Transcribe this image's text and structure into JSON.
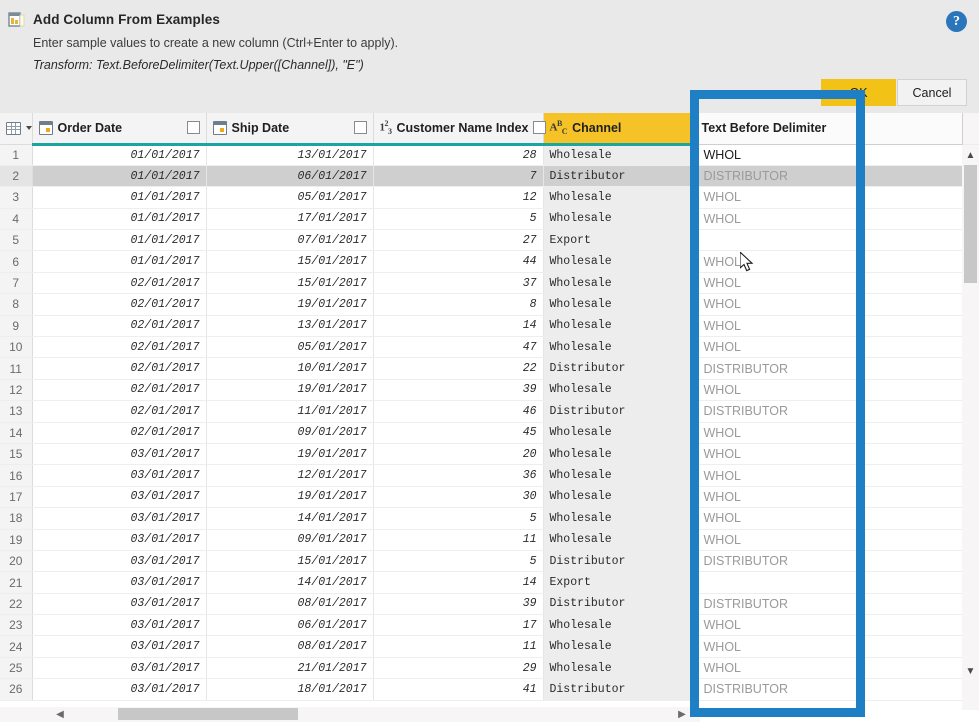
{
  "dialog": {
    "icon": "add-column-icon",
    "title": "Add Column From Examples",
    "subtitle": "Enter sample values to create a new column (Ctrl+Enter to apply).",
    "transform": "Transform: Text.BeforeDelimiter(Text.Upper([Channel]), \"E\")",
    "help_icon": "help-icon",
    "ok_label": "OK",
    "cancel_label": "Cancel"
  },
  "colors": {
    "accent_yellow": "#f2c316",
    "header_highlight": "#f5c327",
    "header_underline_teal": "#1aa5a0",
    "annotation_blue": "#1f7fc4",
    "help_blue": "#2b76bb",
    "selected_row": "#cfcfcf"
  },
  "grid": {
    "index_header_icon": "table-grid-icon",
    "index_header_caret": "chevron-down-icon",
    "columns": [
      {
        "key": "order_date",
        "label": "Order Date",
        "type_icon": "date-type-icon",
        "checkbox": true,
        "highlight": false
      },
      {
        "key": "ship_date",
        "label": "Ship Date",
        "type_icon": "date-type-icon",
        "checkbox": true,
        "highlight": false
      },
      {
        "key": "customer_name_index",
        "label": "Customer Name Index",
        "type_icon": "number-type-icon",
        "checkbox": true,
        "highlight": false
      },
      {
        "key": "channel",
        "label": "Channel",
        "type_icon": "text-type-icon",
        "checkbox": false,
        "highlight": true
      }
    ],
    "new_column": {
      "label": "Text Before Delimiter",
      "is_preview": true
    },
    "rows": [
      {
        "n": "1",
        "order_date": "01/01/2017",
        "ship_date": "13/01/2017",
        "customer_name_index": "28",
        "channel": "Wholesale",
        "preview": "WHOL",
        "entered": true,
        "selected": false
      },
      {
        "n": "2",
        "order_date": "01/01/2017",
        "ship_date": "06/01/2017",
        "customer_name_index": "7",
        "channel": "Distributor",
        "preview": "DISTRIBUTOR",
        "entered": false,
        "selected": true
      },
      {
        "n": "3",
        "order_date": "01/01/2017",
        "ship_date": "05/01/2017",
        "customer_name_index": "12",
        "channel": "Wholesale",
        "preview": "WHOL",
        "entered": false,
        "selected": false
      },
      {
        "n": "4",
        "order_date": "01/01/2017",
        "ship_date": "17/01/2017",
        "customer_name_index": "5",
        "channel": "Wholesale",
        "preview": "WHOL",
        "entered": false,
        "selected": false
      },
      {
        "n": "5",
        "order_date": "01/01/2017",
        "ship_date": "07/01/2017",
        "customer_name_index": "27",
        "channel": "Export",
        "preview": "",
        "entered": false,
        "selected": false
      },
      {
        "n": "6",
        "order_date": "01/01/2017",
        "ship_date": "15/01/2017",
        "customer_name_index": "44",
        "channel": "Wholesale",
        "preview": "WHOL",
        "entered": false,
        "selected": false
      },
      {
        "n": "7",
        "order_date": "02/01/2017",
        "ship_date": "15/01/2017",
        "customer_name_index": "37",
        "channel": "Wholesale",
        "preview": "WHOL",
        "entered": false,
        "selected": false
      },
      {
        "n": "8",
        "order_date": "02/01/2017",
        "ship_date": "19/01/2017",
        "customer_name_index": "8",
        "channel": "Wholesale",
        "preview": "WHOL",
        "entered": false,
        "selected": false
      },
      {
        "n": "9",
        "order_date": "02/01/2017",
        "ship_date": "13/01/2017",
        "customer_name_index": "14",
        "channel": "Wholesale",
        "preview": "WHOL",
        "entered": false,
        "selected": false
      },
      {
        "n": "10",
        "order_date": "02/01/2017",
        "ship_date": "05/01/2017",
        "customer_name_index": "47",
        "channel": "Wholesale",
        "preview": "WHOL",
        "entered": false,
        "selected": false
      },
      {
        "n": "11",
        "order_date": "02/01/2017",
        "ship_date": "10/01/2017",
        "customer_name_index": "22",
        "channel": "Distributor",
        "preview": "DISTRIBUTOR",
        "entered": false,
        "selected": false
      },
      {
        "n": "12",
        "order_date": "02/01/2017",
        "ship_date": "19/01/2017",
        "customer_name_index": "39",
        "channel": "Wholesale",
        "preview": "WHOL",
        "entered": false,
        "selected": false
      },
      {
        "n": "13",
        "order_date": "02/01/2017",
        "ship_date": "11/01/2017",
        "customer_name_index": "46",
        "channel": "Distributor",
        "preview": "DISTRIBUTOR",
        "entered": false,
        "selected": false
      },
      {
        "n": "14",
        "order_date": "02/01/2017",
        "ship_date": "09/01/2017",
        "customer_name_index": "45",
        "channel": "Wholesale",
        "preview": "WHOL",
        "entered": false,
        "selected": false
      },
      {
        "n": "15",
        "order_date": "03/01/2017",
        "ship_date": "19/01/2017",
        "customer_name_index": "20",
        "channel": "Wholesale",
        "preview": "WHOL",
        "entered": false,
        "selected": false
      },
      {
        "n": "16",
        "order_date": "03/01/2017",
        "ship_date": "12/01/2017",
        "customer_name_index": "36",
        "channel": "Wholesale",
        "preview": "WHOL",
        "entered": false,
        "selected": false
      },
      {
        "n": "17",
        "order_date": "03/01/2017",
        "ship_date": "19/01/2017",
        "customer_name_index": "30",
        "channel": "Wholesale",
        "preview": "WHOL",
        "entered": false,
        "selected": false
      },
      {
        "n": "18",
        "order_date": "03/01/2017",
        "ship_date": "14/01/2017",
        "customer_name_index": "5",
        "channel": "Wholesale",
        "preview": "WHOL",
        "entered": false,
        "selected": false
      },
      {
        "n": "19",
        "order_date": "03/01/2017",
        "ship_date": "09/01/2017",
        "customer_name_index": "11",
        "channel": "Wholesale",
        "preview": "WHOL",
        "entered": false,
        "selected": false
      },
      {
        "n": "20",
        "order_date": "03/01/2017",
        "ship_date": "15/01/2017",
        "customer_name_index": "5",
        "channel": "Distributor",
        "preview": "DISTRIBUTOR",
        "entered": false,
        "selected": false
      },
      {
        "n": "21",
        "order_date": "03/01/2017",
        "ship_date": "14/01/2017",
        "customer_name_index": "14",
        "channel": "Export",
        "preview": "",
        "entered": false,
        "selected": false
      },
      {
        "n": "22",
        "order_date": "03/01/2017",
        "ship_date": "08/01/2017",
        "customer_name_index": "39",
        "channel": "Distributor",
        "preview": "DISTRIBUTOR",
        "entered": false,
        "selected": false
      },
      {
        "n": "23",
        "order_date": "03/01/2017",
        "ship_date": "06/01/2017",
        "customer_name_index": "17",
        "channel": "Wholesale",
        "preview": "WHOL",
        "entered": false,
        "selected": false
      },
      {
        "n": "24",
        "order_date": "03/01/2017",
        "ship_date": "08/01/2017",
        "customer_name_index": "11",
        "channel": "Wholesale",
        "preview": "WHOL",
        "entered": false,
        "selected": false
      },
      {
        "n": "25",
        "order_date": "03/01/2017",
        "ship_date": "21/01/2017",
        "customer_name_index": "29",
        "channel": "Wholesale",
        "preview": "WHOL",
        "entered": false,
        "selected": false
      },
      {
        "n": "26",
        "order_date": "03/01/2017",
        "ship_date": "18/01/2017",
        "customer_name_index": "41",
        "channel": "Distributor",
        "preview": "DISTRIBUTOR",
        "entered": false,
        "selected": false
      }
    ]
  },
  "scrollbars": {
    "vertical_up_arrow": "chevron-up-icon",
    "vertical_down_arrow": "chevron-down-icon",
    "horizontal_left_arrow": "chevron-left-icon",
    "horizontal_right_arrow": "chevron-right-icon"
  },
  "annotation": {
    "shape": "rectangle-highlight",
    "color": "#1f7fc4"
  },
  "cursor": {
    "name": "mouse-pointer"
  }
}
